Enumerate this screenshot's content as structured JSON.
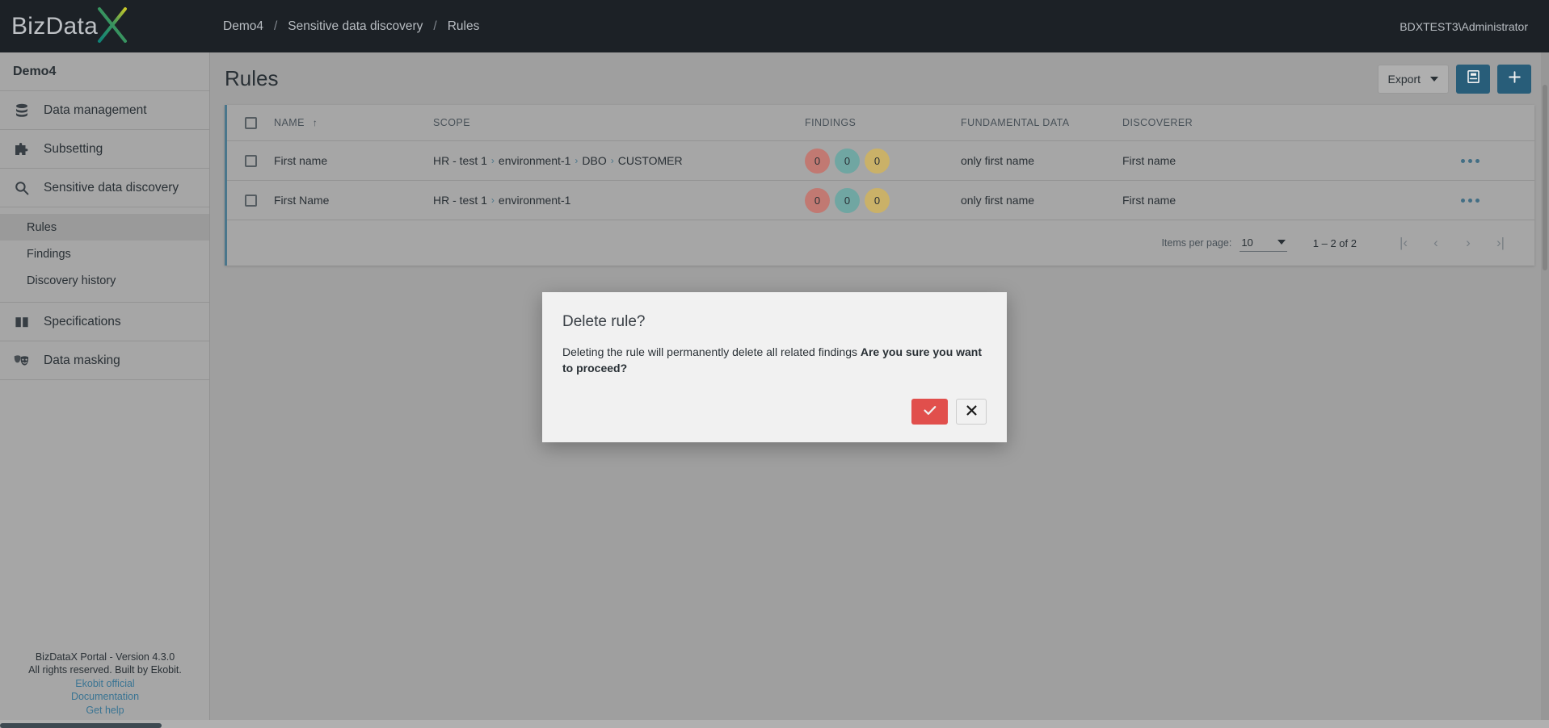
{
  "brand": {
    "name_prefix": "BizData",
    "name_x": "X",
    "accent_teal": "#2a6280",
    "accent_red": "#ef5350",
    "logo_gradient_start": "#0f8a7e",
    "logo_gradient_end": "#d4d42a"
  },
  "topbar": {
    "breadcrumb": [
      {
        "label": "Demo4"
      },
      {
        "label": "Sensitive data discovery"
      },
      {
        "label": "Rules"
      }
    ],
    "separator": "/",
    "user": "BDXTEST3\\Administrator"
  },
  "sidebar": {
    "project": "Demo4",
    "items": [
      {
        "label": "Data management",
        "icon": "database-icon"
      },
      {
        "label": "Subsetting",
        "icon": "puzzle-icon"
      },
      {
        "label": "Sensitive data discovery",
        "icon": "search-icon"
      }
    ],
    "subitems": [
      {
        "label": "Rules",
        "active": true
      },
      {
        "label": "Findings",
        "active": false
      },
      {
        "label": "Discovery history",
        "active": false
      }
    ],
    "items_after": [
      {
        "label": "Specifications",
        "icon": "book-icon"
      },
      {
        "label": "Data masking",
        "icon": "masks-icon"
      }
    ],
    "footer": {
      "version": "BizDataX Portal - Version 4.3.0",
      "rights": "All rights reserved. Built by Ekobit.",
      "links": [
        {
          "label": "Ekobit official"
        },
        {
          "label": "Documentation"
        },
        {
          "label": "Get help"
        }
      ]
    }
  },
  "page": {
    "title": "Rules",
    "toolbar": {
      "export_label": "Export",
      "export_caret": "caret-down-icon",
      "library_icon": "book-reader-icon",
      "add_icon": "plus-icon"
    }
  },
  "table": {
    "columns": [
      {
        "key": "select",
        "label": ""
      },
      {
        "key": "name",
        "label": "NAME",
        "sort": "asc",
        "sort_icon": "arrow-up-icon"
      },
      {
        "key": "scope",
        "label": "SCOPE"
      },
      {
        "key": "findings",
        "label": "FINDINGS"
      },
      {
        "key": "fundamental",
        "label": "FUNDAMENTAL DATA"
      },
      {
        "key": "discoverer",
        "label": "DISCOVERER"
      }
    ],
    "rows": [
      {
        "name": "First name",
        "scope": [
          "HR - test 1",
          "environment-1",
          "DBO",
          "CUSTOMER"
        ],
        "findings": [
          {
            "value": "0",
            "tone": "red"
          },
          {
            "value": "0",
            "tone": "teal"
          },
          {
            "value": "0",
            "tone": "amber"
          }
        ],
        "fundamental": "only first name",
        "discoverer": "First name",
        "menu_icon": "more-horizontal-icon"
      },
      {
        "name": "First Name",
        "scope": [
          "HR - test 1",
          "environment-1"
        ],
        "findings": [
          {
            "value": "0",
            "tone": "red"
          },
          {
            "value": "0",
            "tone": "teal"
          },
          {
            "value": "0",
            "tone": "amber"
          }
        ],
        "fundamental": "only first name",
        "discoverer": "First name",
        "menu_icon": "more-horizontal-icon"
      }
    ],
    "scope_separator": "›"
  },
  "paginator": {
    "items_per_page_label": "Items per page:",
    "items_per_page_value": "10",
    "range_label": "1 – 2 of 2",
    "first_icon": "|‹",
    "prev_icon": "‹",
    "next_icon": "›",
    "last_icon": "›|"
  },
  "dialog": {
    "title": "Delete rule?",
    "body_normal": "Deleting the rule will permanently delete all related findings ",
    "body_bold": "Are you sure you want to proceed?",
    "confirm_icon": "check-icon",
    "cancel_icon": "close-icon"
  }
}
